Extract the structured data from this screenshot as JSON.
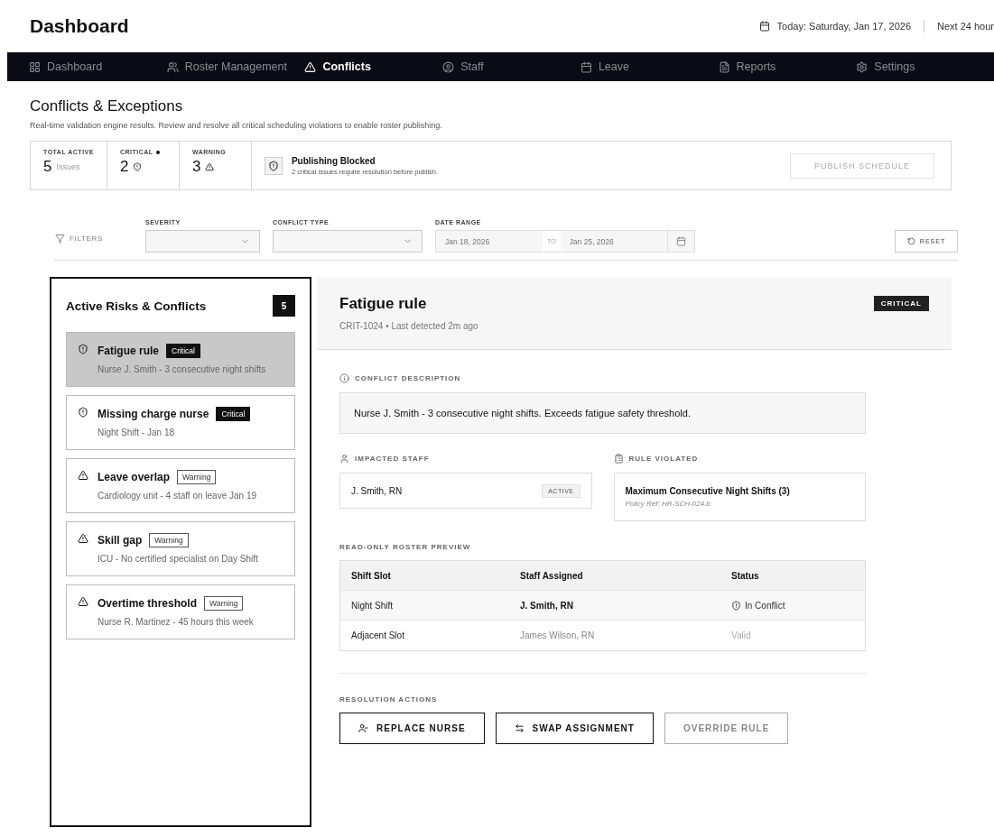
{
  "header": {
    "title": "Dashboard",
    "date": "Today: Saturday, Jan 17, 2026",
    "range": "Next 24 hour"
  },
  "nav": [
    {
      "label": "Dashboard",
      "selected": false
    },
    {
      "label": "Roster Management",
      "selected": false
    },
    {
      "label": "Conflicts",
      "selected": true
    },
    {
      "label": "Staff",
      "selected": false
    },
    {
      "label": "Leave",
      "selected": false
    },
    {
      "label": "Reports",
      "selected": false
    },
    {
      "label": "Settings",
      "selected": false
    }
  ],
  "page": {
    "title": "Conflicts & Exceptions",
    "subtitle": "Real-time validation engine results. Review and resolve all critical scheduling violations to enable roster publishing."
  },
  "stats": [
    {
      "kind": "total",
      "label": "TOTAL ACTIVE",
      "value": "5",
      "unit": "Issues"
    },
    {
      "kind": "critical",
      "label": "CRITICAL",
      "value": "2"
    },
    {
      "kind": "warning",
      "label": "WARNING",
      "value": "3"
    }
  ],
  "blocked": {
    "title": "Publishing Blocked",
    "text": "2 critical issues require resolution before publish.",
    "button": "PUBLISH SCHEDULE",
    "button_disabled": true
  },
  "filters": {
    "label": "FILTERS",
    "severity": "SEVERITY",
    "conflict_type": "CONFLICT TYPE",
    "date_range": "DATE RANGE",
    "from": "Jan 18, 2026",
    "to_label": "TO",
    "to": "Jan 25, 2026",
    "reset": "RESET"
  },
  "risks": {
    "title": "Active Risks & Conflicts",
    "count": "5",
    "items": [
      {
        "kind": "critical",
        "title": "Fatigue rule",
        "badge": "Critical",
        "detail": "Nurse J. Smith - 3 consecutive night shifts",
        "selected": true
      },
      {
        "kind": "critical",
        "title": "Missing charge nurse",
        "badge": "Critical",
        "detail": "Night Shift - Jan 18",
        "selected": false
      },
      {
        "kind": "warning",
        "title": "Leave overlap",
        "badge": "Warning",
        "detail": "Cardiology unit - 4 staff on leave Jan 19",
        "selected": false
      },
      {
        "kind": "warning",
        "title": "Skill gap",
        "badge": "Warning",
        "detail": "ICU - No certified specialist on Day Shift",
        "selected": false
      },
      {
        "kind": "warning",
        "title": "Overtime threshold",
        "badge": "Warning",
        "detail": "Nurse R. Martinez - 45 hours this week",
        "selected": false
      }
    ]
  },
  "detail": {
    "title": "Fatigue rule",
    "meta": "CRIT-1024 • Last detected 2m ago",
    "badge": "CRITICAL",
    "description_label": "CONFLICT DESCRIPTION",
    "description": "Nurse J. Smith - 3 consecutive night shifts. Exceeds fatigue safety threshold.",
    "staff_label": "IMPACTED STAFF",
    "staff": "J. Smith, RN",
    "staff_status": "ACTIVE",
    "rule_label": "RULE VIOLATED",
    "rule": "Maximum Consecutive Night Shifts (3)",
    "policy": "Policy Ref: HR-SCH-024.b",
    "preview_label": "READ-ONLY ROSTER PREVIEW",
    "columns": [
      "Shift Slot",
      "Staff Assigned",
      "Status"
    ],
    "rows": [
      {
        "kind": "conflict",
        "slot": "Night Shift",
        "staff": "J. Smith, RN",
        "status": "In Conflict"
      },
      {
        "kind": "valid",
        "slot": "Adjacent Slot",
        "staff": "James Wilson, RN",
        "status": "Valid"
      }
    ],
    "actions_label": "RESOLUTION ACTIONS",
    "actions": [
      {
        "label": "REPLACE NURSE",
        "disabled": false
      },
      {
        "label": "SWAP ASSIGNMENT",
        "disabled": false
      },
      {
        "label": "OVERRIDE RULE",
        "disabled": true
      }
    ]
  }
}
